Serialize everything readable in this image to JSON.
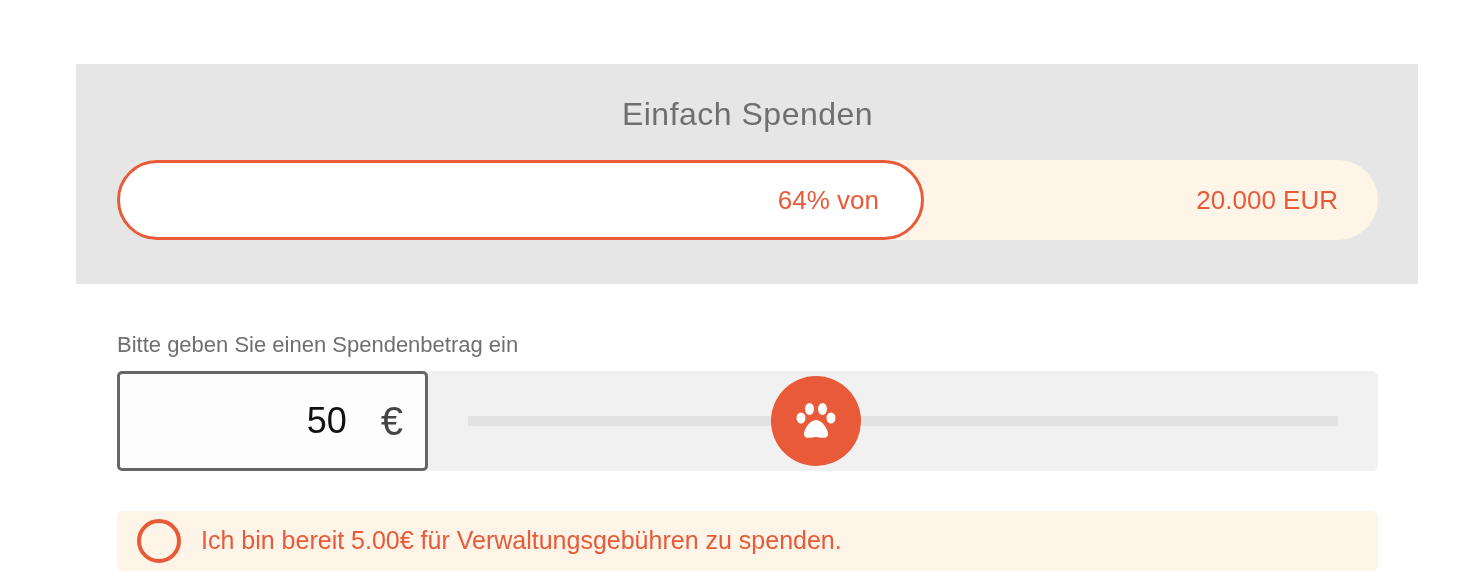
{
  "header": {
    "title": "Einfach Spenden"
  },
  "progress": {
    "level": 0.64,
    "reached_label": "64% von",
    "goal": "20.000 EUR"
  },
  "amount": {
    "label": "Bitte geben Sie einen Spendenbetrag ein",
    "value": "50",
    "currency": "€"
  },
  "slider": {
    "level": 0.4
  },
  "fee_option": {
    "label": "Ich bin bereit 5.00€ für Verwaltungsgebühren zu spenden.",
    "checked": false
  }
}
